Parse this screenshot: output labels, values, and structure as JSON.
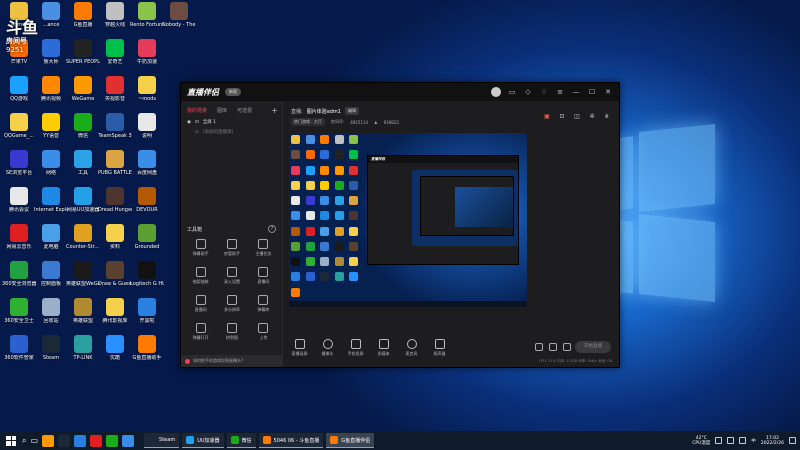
{
  "room_badge": {
    "big": "斗鱼",
    "line1": "房间号",
    "line2": "9251"
  },
  "desktop_icons": [
    {
      "label": "Adm...",
      "color": "#f0c040"
    },
    {
      "label": "...ance",
      "color": "#4a90e2"
    },
    {
      "label": "G鱼直播",
      "color": "#ff7a00"
    },
    {
      "label": "穿越火线",
      "color": "#c0c0c0"
    },
    {
      "label": "Rento Fortune -...",
      "color": "#8bc34a"
    },
    {
      "label": "Nobody - The Turna...",
      "color": "#6d4c41"
    },
    {
      "label": "芒果TV",
      "color": "#ff6a00"
    },
    {
      "label": "鲁大师",
      "color": "#2b6cd8"
    },
    {
      "label": "SUPER PEOPLE CBT",
      "color": "#222"
    },
    {
      "label": "爱奇艺",
      "color": "#00c04b"
    },
    {
      "label": "牛奶加速",
      "color": "#e63b5a"
    },
    {
      "label": "QQ游戏",
      "color": "#1aa0ff"
    },
    {
      "label": "腾讯视频",
      "color": "#ff8800"
    },
    {
      "label": "WeGame",
      "color": "#ff9900"
    },
    {
      "label": "央视影音",
      "color": "#e03030"
    },
    {
      "label": "~mods",
      "color": "#f5d04a"
    },
    {
      "label": "QQGame_...",
      "color": "#f5d04a"
    },
    {
      "label": "YY语音",
      "color": "#ffcc00"
    },
    {
      "label": "微信",
      "color": "#1aad19"
    },
    {
      "label": "TeamSpeak 3",
      "color": "#2a5ca8"
    },
    {
      "label": "说明",
      "color": "#e8e8e8"
    },
    {
      "label": "SE浏览平台",
      "color": "#3a3ad0"
    },
    {
      "label": "网络",
      "color": "#3b8de8"
    },
    {
      "label": "工具",
      "color": "#2ba2e6"
    },
    {
      "label": "PUBG BATTLEGR...",
      "color": "#d9a441"
    },
    {
      "label": "百度网盘",
      "color": "#3a8ee8"
    },
    {
      "label": "腾讯会议",
      "color": "#e8e8e8"
    },
    {
      "label": "Internet Explorer",
      "color": "#1e88e5"
    },
    {
      "label": "网易UU加速器",
      "color": "#22a0e8"
    },
    {
      "label": "Dread Hunger",
      "color": "#4e342e"
    },
    {
      "label": "DEVOUR",
      "color": "#b35a00"
    },
    {
      "label": "网易云音乐",
      "color": "#e02020"
    },
    {
      "label": "此电脑",
      "color": "#4aa0e8"
    },
    {
      "label": "Counter-Str... Global Off...",
      "color": "#e0a020"
    },
    {
      "label": "资料",
      "color": "#f5d04a"
    },
    {
      "label": "Grounded",
      "color": "#5aa030"
    },
    {
      "label": "360安全浏览器",
      "color": "#20a040"
    },
    {
      "label": "控制面板",
      "color": "#3a7ad0"
    },
    {
      "label": "英雄联盟WeGame版",
      "color": "#1a1a1a"
    },
    {
      "label": "Draw & Guess",
      "color": "#5a4030"
    },
    {
      "label": "Logitech G HUB",
      "color": "#111"
    },
    {
      "label": "360安全卫士",
      "color": "#30b030"
    },
    {
      "label": "回收站",
      "color": "#9ab0c8"
    },
    {
      "label": "英雄联盟",
      "color": "#b08a30"
    },
    {
      "label": "腾讯影视库",
      "color": "#f5d04a"
    },
    {
      "label": "开黑啦",
      "color": "#2a80e0"
    },
    {
      "label": "360软件管家",
      "color": "#2a60d0"
    },
    {
      "label": "Steam",
      "color": "#1b2838"
    },
    {
      "label": "TP-LINK",
      "color": "#2aa0a0"
    },
    {
      "label": "优酷",
      "color": "#2a90ff"
    },
    {
      "label": "G鱼直播助手",
      "color": "#ff7a00"
    }
  ],
  "app": {
    "logo": "直播伴侣",
    "version": "新版",
    "left_tabs": [
      "我的场景",
      "图库",
      "可选视"
    ],
    "scenes": [
      {
        "name": "全屏 1",
        "dim": false
      },
      {
        "name": "(添加的直播源)",
        "dim": true
      }
    ],
    "toolbox_title": "工具箱",
    "tools": [
      "弹幕助手",
      "房管助手",
      "主播任务",
      "抽奖抽装",
      "录入设置",
      "直播间",
      "直播间",
      "多分辨率",
      "弹幕库",
      "弹幕打开",
      "拼到图",
      "上传"
    ],
    "footer_text": "如何把手机游戏投到直播头?",
    "stream": {
      "title_label": "直播:",
      "title": "图片体验adm1",
      "edit": "编辑",
      "category": "热门游戏 · 大厅",
      "room_label": "房间号:",
      "room": "4925114",
      "viewers": "939822"
    },
    "bottom_tools": [
      "直播录屏",
      "摄像头",
      "手机投屏",
      "多媒体",
      "麦克风",
      "扬声器"
    ],
    "go_live": "开始直播",
    "status_text": "CPU: 21% 内存: 4.2GB 码率: 0kb/s 丢帧: 0%"
  },
  "taskbar": {
    "tasks": [
      {
        "label": "Steam",
        "color": "#1b2838",
        "active": false
      },
      {
        "label": "UU加速器",
        "color": "#22a0e8",
        "active": false
      },
      {
        "label": "微信",
        "color": "#1aad19",
        "active": false
      },
      {
        "label": "5046 06 - 斗鱼直播",
        "color": "#ff7a00",
        "active": false
      },
      {
        "label": "G鱼直播伴侣",
        "color": "#ff7a00",
        "active": true
      }
    ],
    "pins": [
      "#ff9900",
      "#1b2838",
      "#2a80e0",
      "#e02020",
      "#1aad19",
      "#3b8de8"
    ],
    "temp": "42°C",
    "cpu_label": "CPU温度",
    "ime": "中",
    "time": "17:02",
    "date": "2022/2/26"
  }
}
